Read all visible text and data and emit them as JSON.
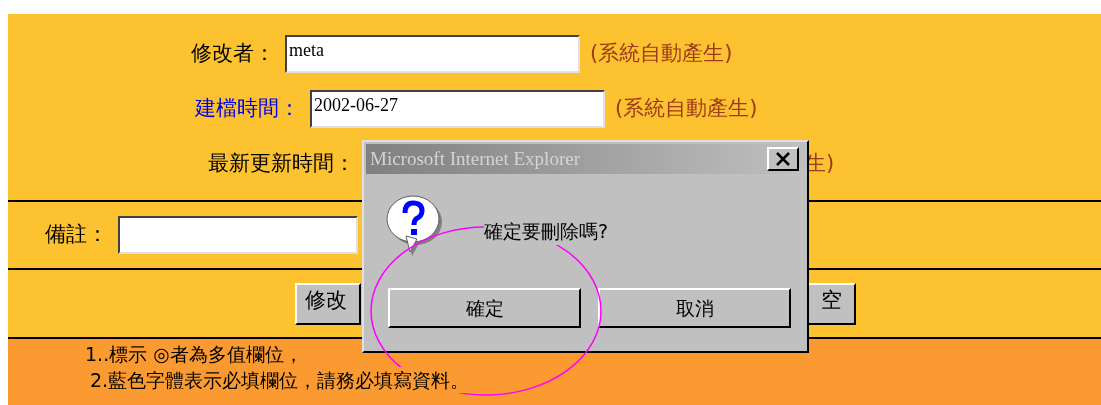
{
  "form_fields": [
    {
      "label": "修改者：",
      "required": false,
      "value": "meta",
      "note": "(系統自動產生)"
    },
    {
      "label": "建檔時間：",
      "required": true,
      "value": "2002-06-27",
      "note": "(系統自動產生)"
    },
    {
      "label": "最新更新時間：",
      "required": false,
      "note": "生)"
    }
  ],
  "remark": {
    "label": "備註："
  },
  "buttons": [
    "修改",
    "空"
  ],
  "dialog": {
    "title": "Microsoft Internet Explorer",
    "message": "確定要刪除嗎?",
    "buttons": [
      "確定",
      "取消"
    ]
  },
  "notes": [
    "1..標示 ◎者為多值欄位，",
    "2.藍色字體表示必填欄位，請務必填寫資料。"
  ]
}
